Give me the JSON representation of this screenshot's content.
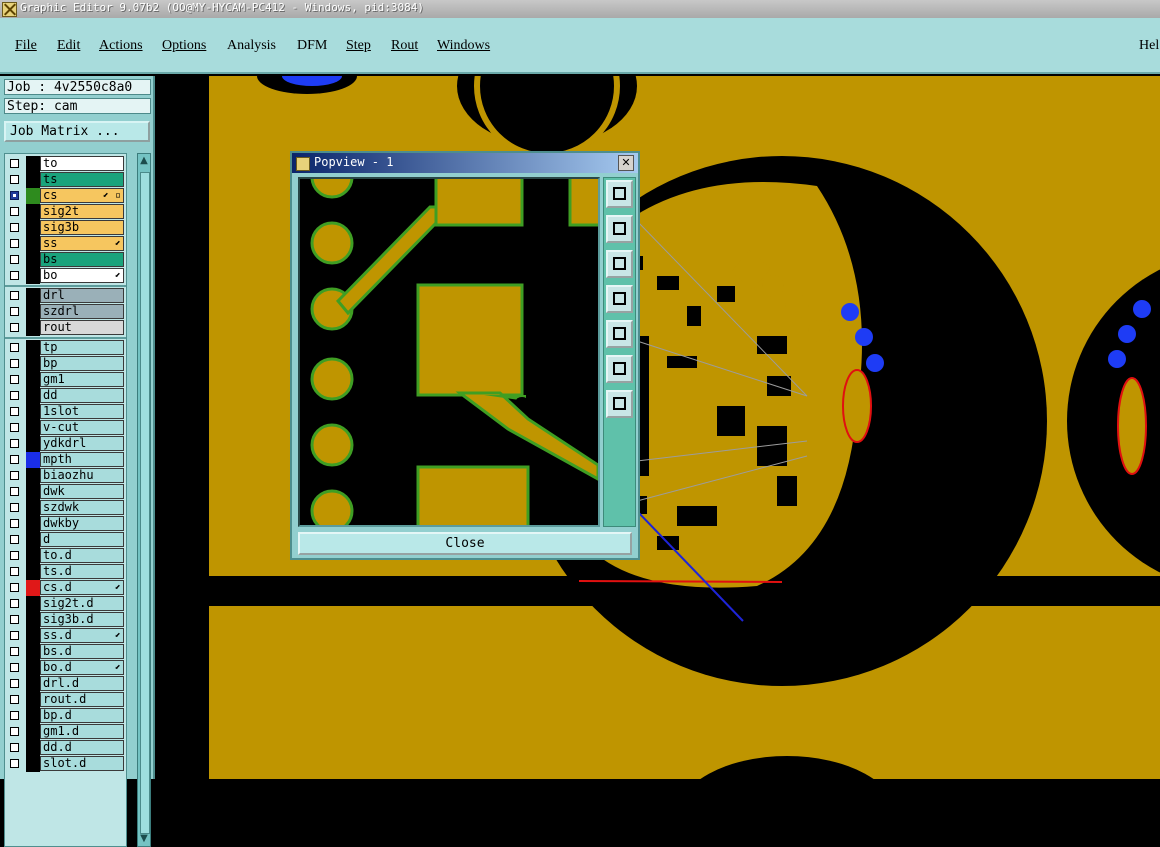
{
  "window": {
    "title": "Graphic Editor 9.07b2 (OO@MY-HYCAM-PC412 - Windows, pid:3084)"
  },
  "menu": {
    "items": [
      {
        "label": "File"
      },
      {
        "label": "Edit"
      },
      {
        "label": "Actions"
      },
      {
        "label": "Options"
      },
      {
        "label": "Analysis"
      },
      {
        "label": "DFM"
      },
      {
        "label": "Step"
      },
      {
        "label": "Rout"
      },
      {
        "label": "Windows"
      },
      {
        "label": "Hel"
      }
    ]
  },
  "job": {
    "label": "Job : 4v2550c8a0",
    "step": "Step: cam",
    "matrix_button": "Job Matrix ..."
  },
  "layers": [
    {
      "name": "to",
      "bg": "#ffffff",
      "swatch": "#000000"
    },
    {
      "name": "ts",
      "bg": "#1aa37c",
      "swatch": "#000000"
    },
    {
      "name": "cs",
      "bg": "#f6c65f",
      "swatch": "#2e8b1e",
      "selected": true,
      "mark": "⬋ ▫"
    },
    {
      "name": "sig2t",
      "bg": "#f6c65f",
      "swatch": "#000000"
    },
    {
      "name": "sig3b",
      "bg": "#f6c65f",
      "swatch": "#000000"
    },
    {
      "name": "ss",
      "bg": "#f6c65f",
      "swatch": "#000000",
      "mark": "⬋"
    },
    {
      "name": "bs",
      "bg": "#1aa37c",
      "swatch": "#000000"
    },
    {
      "name": "bo",
      "bg": "#ffffff",
      "swatch": "#000000",
      "mark": "⬋"
    },
    {
      "sep": true
    },
    {
      "name": "drl",
      "bg": "#9ab0b8",
      "swatch": "#000000"
    },
    {
      "name": "szdrl",
      "bg": "#9ab0b8",
      "swatch": "#000000"
    },
    {
      "name": "rout",
      "bg": "#d8d8d8",
      "swatch": "#000000"
    },
    {
      "sep": true
    },
    {
      "name": "tp",
      "bg": "#a8dcdc",
      "swatch": "#000000"
    },
    {
      "name": "bp",
      "bg": "#a8dcdc",
      "swatch": "#000000"
    },
    {
      "name": "gm1",
      "bg": "#a8dcdc",
      "swatch": "#000000"
    },
    {
      "name": "dd",
      "bg": "#a8dcdc",
      "swatch": "#000000"
    },
    {
      "name": "1slot",
      "bg": "#a8dcdc",
      "swatch": "#000000"
    },
    {
      "name": "v-cut",
      "bg": "#a8dcdc",
      "swatch": "#000000"
    },
    {
      "name": "ydkdrl",
      "bg": "#a8dcdc",
      "swatch": "#000000"
    },
    {
      "name": "mpth",
      "bg": "#a8dcdc",
      "swatch": "#1a2ee8"
    },
    {
      "name": "biaozhu",
      "bg": "#a8dcdc",
      "swatch": "#000000"
    },
    {
      "name": "dwk",
      "bg": "#a8dcdc",
      "swatch": "#000000"
    },
    {
      "name": "szdwk",
      "bg": "#a8dcdc",
      "swatch": "#000000"
    },
    {
      "name": "dwkby",
      "bg": "#a8dcdc",
      "swatch": "#000000"
    },
    {
      "name": "d",
      "bg": "#a8dcdc",
      "swatch": "#000000"
    },
    {
      "name": "to.d",
      "bg": "#a8dcdc",
      "swatch": "#000000"
    },
    {
      "name": "ts.d",
      "bg": "#a8dcdc",
      "swatch": "#000000"
    },
    {
      "name": "cs.d",
      "bg": "#a8dcdc",
      "swatch": "#e01818",
      "mark": "⬋"
    },
    {
      "name": "sig2t.d",
      "bg": "#a8dcdc",
      "swatch": "#000000"
    },
    {
      "name": "sig3b.d",
      "bg": "#a8dcdc",
      "swatch": "#000000"
    },
    {
      "name": "ss.d",
      "bg": "#a8dcdc",
      "swatch": "#000000",
      "mark": "⬋"
    },
    {
      "name": "bs.d",
      "bg": "#a8dcdc",
      "swatch": "#000000"
    },
    {
      "name": "bo.d",
      "bg": "#a8dcdc",
      "swatch": "#000000",
      "mark": "⬋"
    },
    {
      "name": "drl.d",
      "bg": "#a8dcdc",
      "swatch": "#000000"
    },
    {
      "name": "rout.d",
      "bg": "#a8dcdc",
      "swatch": "#000000"
    },
    {
      "name": "bp.d",
      "bg": "#a8dcdc",
      "swatch": "#000000"
    },
    {
      "name": "gm1.d",
      "bg": "#a8dcdc",
      "swatch": "#000000"
    },
    {
      "name": "dd.d",
      "bg": "#a8dcdc",
      "swatch": "#000000"
    },
    {
      "name": "slot.d",
      "bg": "#a8dcdc",
      "swatch": "#000000"
    }
  ],
  "popview": {
    "title": "Popview - 1",
    "close_label": "Close"
  },
  "colors": {
    "copper": "#bf9500",
    "mask_edge": "#3f9e23",
    "drill": "#1e3cf5",
    "panel": "#a8dcdc"
  }
}
